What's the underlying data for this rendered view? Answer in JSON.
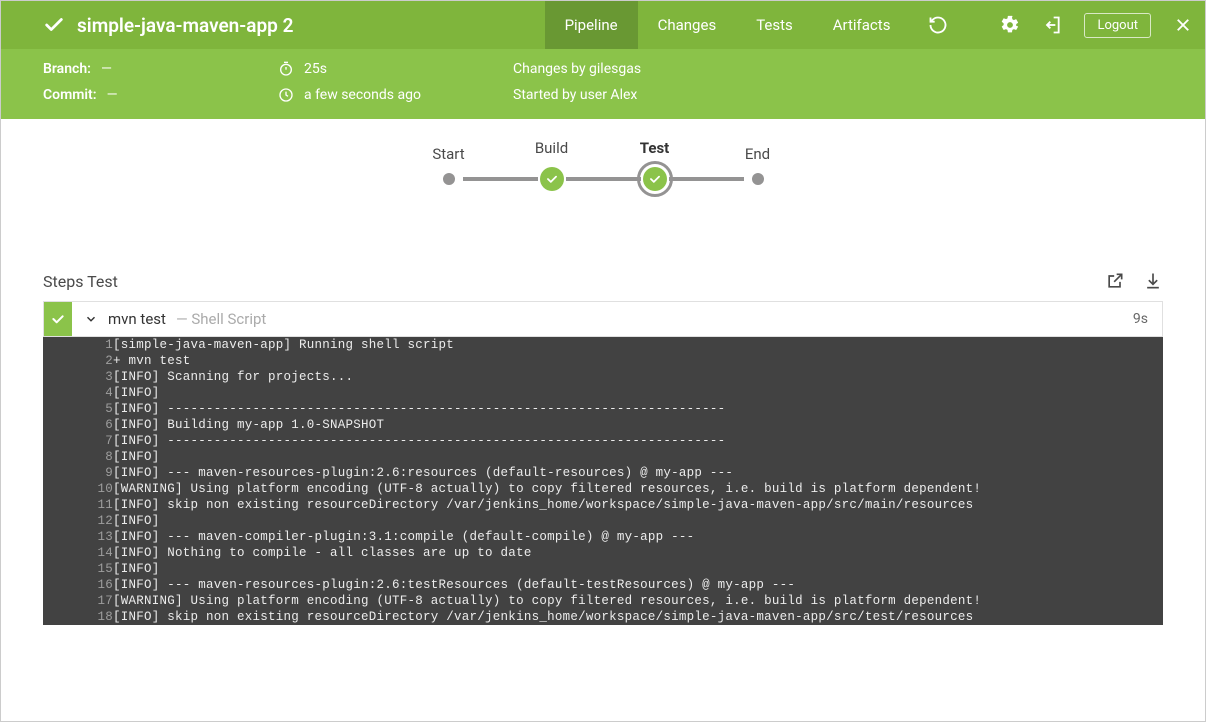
{
  "header": {
    "title": "simple-java-maven-app 2",
    "tabs": [
      {
        "label": "Pipeline",
        "active": true
      },
      {
        "label": "Changes",
        "active": false
      },
      {
        "label": "Tests",
        "active": false
      },
      {
        "label": "Artifacts",
        "active": false
      }
    ],
    "logout_label": "Logout"
  },
  "meta": {
    "branch_label": "Branch:",
    "branch_value": "—",
    "commit_label": "Commit:",
    "commit_value": "—",
    "duration": "25s",
    "age": "a few seconds ago",
    "changes": "Changes by gilesgas",
    "started": "Started by user Alex"
  },
  "stages": [
    {
      "label": "Start",
      "type": "dot"
    },
    {
      "label": "Build",
      "type": "success"
    },
    {
      "label": "Test",
      "type": "success",
      "selected": true
    },
    {
      "label": "End",
      "type": "dot"
    }
  ],
  "steps": {
    "section_title": "Steps Test",
    "rows": [
      {
        "name": "mvn test",
        "desc": "— Shell Script",
        "time": "9s"
      }
    ]
  },
  "log_lines": [
    "[simple-java-maven-app] Running shell script",
    "+ mvn test",
    "[INFO] Scanning for projects...",
    "[INFO] ",
    "[INFO] ------------------------------------------------------------------------",
    "[INFO] Building my-app 1.0-SNAPSHOT",
    "[INFO] ------------------------------------------------------------------------",
    "[INFO] ",
    "[INFO] --- maven-resources-plugin:2.6:resources (default-resources) @ my-app ---",
    "[WARNING] Using platform encoding (UTF-8 actually) to copy filtered resources, i.e. build is platform dependent!",
    "[INFO] skip non existing resourceDirectory /var/jenkins_home/workspace/simple-java-maven-app/src/main/resources",
    "[INFO] ",
    "[INFO] --- maven-compiler-plugin:3.1:compile (default-compile) @ my-app ---",
    "[INFO] Nothing to compile - all classes are up to date",
    "[INFO] ",
    "[INFO] --- maven-resources-plugin:2.6:testResources (default-testResources) @ my-app ---",
    "[WARNING] Using platform encoding (UTF-8 actually) to copy filtered resources, i.e. build is platform dependent!",
    "[INFO] skip non existing resourceDirectory /var/jenkins_home/workspace/simple-java-maven-app/src/test/resources"
  ]
}
